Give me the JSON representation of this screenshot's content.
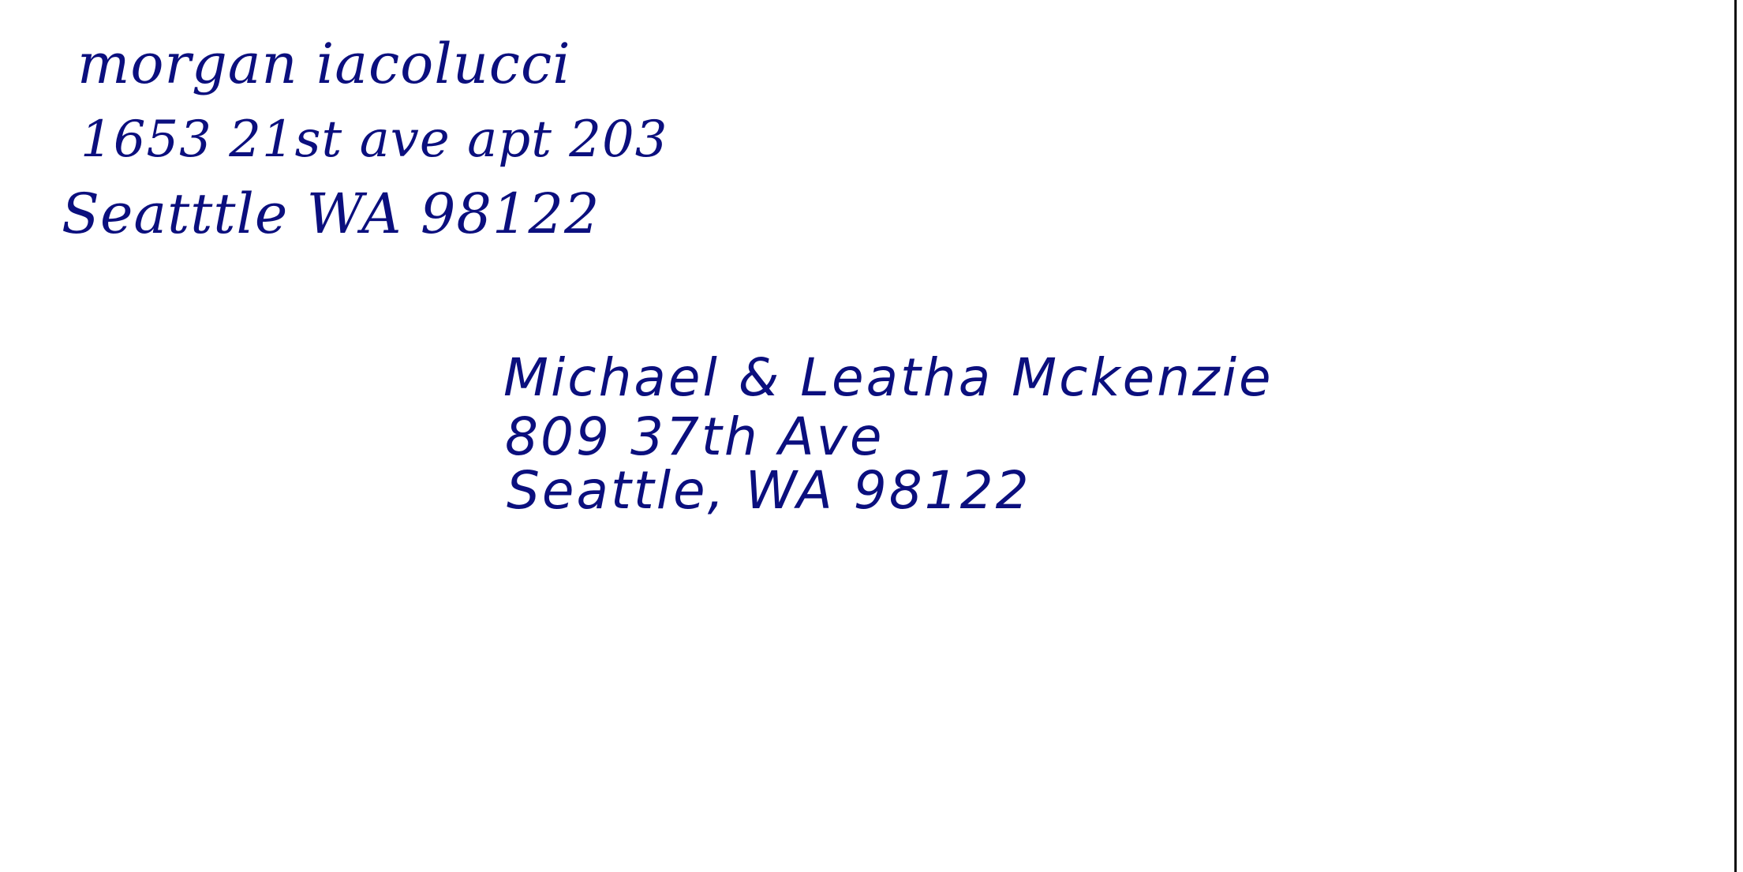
{
  "envelope": {
    "ink_color": "#0b0f7e",
    "return_address": {
      "name": "morgan iacolucci",
      "street": "1653 21st ave apt 203",
      "city_line": "Seatttle WA 98122"
    },
    "recipient_address": {
      "name": "Michael & Leatha Mckenzie",
      "street": "809 37th Ave",
      "city_line": "Seattle, WA 98122"
    }
  }
}
